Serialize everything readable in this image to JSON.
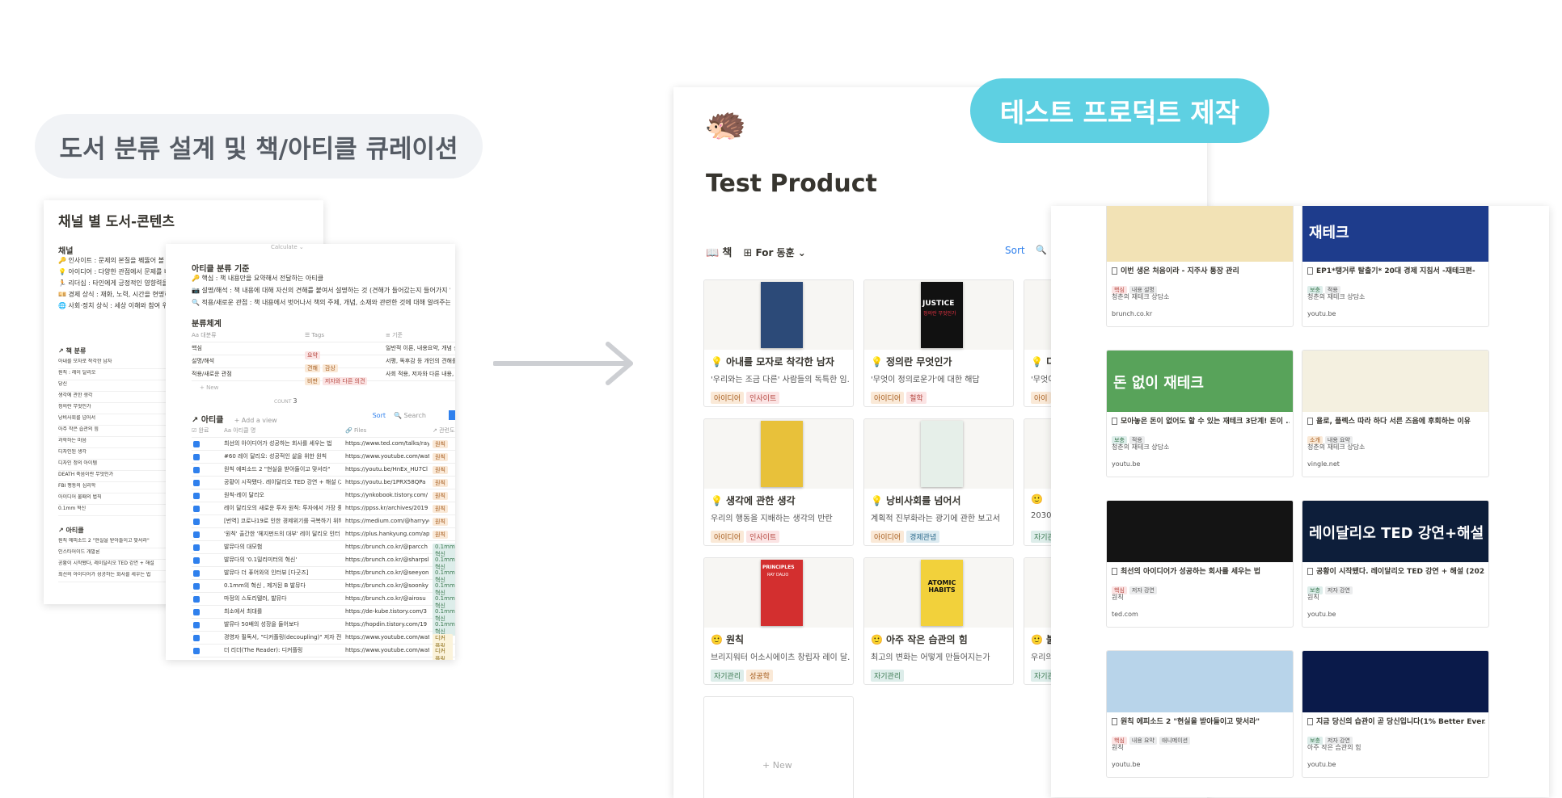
{
  "headings": {
    "left": "도서 분류 설계 및 책/아티클 큐레이션",
    "right": "테스트 프로덕트 제작"
  },
  "doc1": {
    "title": "채널 별 도서-콘텐츠",
    "section": "채널",
    "lines": [
      "🔑 인사이트 : 문제의 본질을 꿰뚫어 볼 수 있는",
      "💡 아이디어 : 다양한 관점에서 문제를 바라볼",
      "🏃 리더십 : 타인에게 긍정적인 영향력을 발휘",
      "💴 경제 상식 : 재화, 노력, 시간을 현명하게 관",
      "🌐 사회·정치 상식 : 세상 이해와 참여 위한 사"
    ],
    "sub1": "↗ 책 분류",
    "rows": [
      "아내를 모자로 착각한 남자",
      "원칙 : 레이 달리오",
      "당신",
      "생각에 관한 생각",
      "정의란 무엇인가",
      "낭비사회를 넘어서",
      "아주 작은 습관의 힘",
      "과학하는 마음",
      "디자인된 생각",
      "디자인 정의 아이템",
      "DEATH 죽음이란 무엇인가",
      "FBI 행동의 심리학",
      "아이디어 불패의 법칙",
      "0.1mm 혁신"
    ],
    "sub2": "↗ 아티클",
    "rows2": [
      "원칙 에피소드 2 \"현실을 받아들이고 맞서라\"",
      "인스타어이드 개발론",
      "공황이 시작됐다, 레이달리오 TED 강연 + 해설",
      "최선의 아이디어가 성공하는 회사를 세우는 법"
    ]
  },
  "doc2": {
    "calc": "Calculate ⌄",
    "title": "아티클 분류 기준",
    "criteria": [
      "🔑 핵심 : 책 내용만을 요약해서 전달하는 아티클",
      "📷 설명/해석 : 책 내용에 대해 자신의 견해를 붙여서 설명하는 것 (견해가 들어갔는지 들어가지 않았는지)",
      "🔍 적용/새로운 관점 : 책 내용에서 벗어나서 책의 주제, 개념, 소재와 관련한 것에 대해 알려주는 아티클"
    ],
    "system_title": "분류체계",
    "cols": [
      "Aa 대분류",
      "☰ Tags",
      "≡ 기준"
    ],
    "cats": [
      {
        "name": "핵심",
        "tags": [
          "요약"
        ],
        "desc": "일반적 이론, 내용요약, 개념 설"
      },
      {
        "name": "설명/해석",
        "tags": [
          "견해",
          "감상"
        ],
        "desc": "서평, 독후감 등 개인의 견해를 ·"
      },
      {
        "name": "적용/새로운 관점",
        "tags": [
          "비판",
          "저자와 다른 의견"
        ],
        "desc": "사회 적용, 저자와 다른 내용, 다"
      }
    ],
    "new": "+ New",
    "count_label": "COUNT",
    "count": "3",
    "articles_title": "↗ 아티클",
    "add_view": "+ Add a view",
    "sort": "Sort",
    "search": "🔍 Search",
    "tcols": [
      "☑ 완료",
      "Aa 아티클 명",
      "🔗 Files",
      "↗ 관련도서"
    ],
    "articles": [
      {
        "t": "최선의 아이디어가 성공하는 회사를 세우는 법",
        "u": "https://www.ted.com/talks/ray",
        "g": "원칙"
      },
      {
        "t": "#60 레이 달리오: 성공적인 삶을 위한 원칙",
        "u": "https://www.youtube.com/wat",
        "g": "원칙"
      },
      {
        "t": "원칙 에피소드 2 \"현실을 받아들이고 맞서라\"",
        "u": "https://youtu.be/HnEx_HU7Cl",
        "g": "원칙"
      },
      {
        "t": "공황이 시작됐다. 레이달리오 TED 강연 + 해설 (2",
        "u": "https://youtu.be/1PRX58QPa",
        "g": "원칙"
      },
      {
        "t": "원칙-레이 달리오",
        "u": "https://ynkobook.tistory.com/",
        "g": "원칙"
      },
      {
        "t": "레이 달리오의 새로운 투자 원칙: 투자에서 가장 중",
        "u": "https://ppss.kr/archives/2019",
        "g": "원칙"
      },
      {
        "t": "[번역] 코로나19로 인한 경제위기를 극복하기 위해",
        "u": "https://medium.com/@harryyc",
        "g": "원칙"
      },
      {
        "t": "'원칙' 출간한 '헤지펀드의 대부' 레이 달리오 인터",
        "u": "https://plus.hankyung.com/ap",
        "g": "원칙"
      },
      {
        "t": "발뮤다의 대모험",
        "u": "https://brunch.co.kr/@parcch",
        "g": "0.1mm혁신"
      },
      {
        "t": "발뮤다의 '0.1밀리미터의 혁신'",
        "u": "https://brunch.co.kr/@sharpsl",
        "g": "0.1mm혁신"
      },
      {
        "t": "발뮤다 더 퓨어와의 인터뷰 [다굿즈]",
        "u": "https://brunch.co.kr/@seeyon",
        "g": "0.1mm혁신"
      },
      {
        "t": "0.1mm의 혁신 , 제거된 B 발뮤다",
        "u": "https://brunch.co.kr/@soonky",
        "g": "0.1mm혁신"
      },
      {
        "t": "마정의 스토리텔러, 발뮤다",
        "u": "https://brunch.co.kr/@airosu",
        "g": "0.1mm혁신"
      },
      {
        "t": "최소에서 최대를",
        "u": "https://de-kube.tistory.com/3",
        "g": "0.1mm혁신"
      },
      {
        "t": "발뮤다 50배의 성장을 들어보다",
        "u": "https://hopdin.tistory.com/19",
        "g": "0.1mm혁신"
      },
      {
        "t": "경영자 필독서, \"디커플링(decoupling)\" 저자 전",
        "u": "https://www.youtube.com/wat",
        "g": "디커플링"
      },
      {
        "t": "더 리더(The Reader): 디커플링",
        "u": "https://www.youtube.com/wat",
        "g": "디커플링"
      }
    ]
  },
  "product": {
    "emoji": "🦔",
    "title": "Test Product",
    "db_icon": "📖",
    "db_name": "책",
    "view_icon": "⊞",
    "view": "For 동훈 ⌄",
    "sort": "Sort",
    "search_icon": "🔍",
    "new_label": "+ New",
    "books": [
      {
        "icon": "💡",
        "title": "아내를 모자로 착각한 남자",
        "desc": "'우리와는 조금 다른' 사람들의 독특한 임...",
        "tags": [
          "아이디어",
          "인사이트"
        ],
        "cover": "#2c4a78"
      },
      {
        "icon": "💡",
        "title": "정의란 무엇인가",
        "desc": "'무엇이 정의로운가'에 대한 해답",
        "tags": [
          "아이디어",
          "철학"
        ],
        "cover": "#111111"
      },
      {
        "icon": "💡",
        "title": "디",
        "desc": "'무엇이",
        "tags": [
          "아이"
        ],
        "cover": "#dddddd"
      },
      {
        "icon": "💡",
        "title": "생각에 관한 생각",
        "desc": "우리의 행동을 지배하는 생각의 반란",
        "tags": [
          "아이디어",
          "인사이트"
        ],
        "cover": "#e8c13a"
      },
      {
        "icon": "💡",
        "title": "낭비사회를 넘어서",
        "desc": "계획적 진부화라는 광기에 관한 보고서",
        "tags": [
          "아이디어",
          "경제관념"
        ],
        "cover": "#e6efe9"
      },
      {
        "icon": "🙂",
        "title": "",
        "desc": "2030",
        "tags": [
          "자기관"
        ],
        "cover": "#dddddd"
      },
      {
        "icon": "🙂",
        "title": "원칙",
        "desc": "브리지워터 어소시에이츠 창립자 레이 달...",
        "tags": [
          "자기관리",
          "성공학"
        ],
        "cover": "#d32f2f"
      },
      {
        "icon": "🙂",
        "title": "아주 작은 습관의 힘",
        "desc": "최고의 변화는 어떻게 만들어지는가",
        "tags": [
          "자기관리"
        ],
        "cover": "#f2d13b"
      },
      {
        "icon": "🙂",
        "title": "불",
        "desc": "우리의",
        "tags": [
          "자기관"
        ],
        "cover": "#dddddd"
      }
    ],
    "cover_texts": {
      "justice": "JUSTICE",
      "justice_sub": "정의란 무엇인가",
      "principles": "PRINCIPLES",
      "principles_sub": "RAY DALIO",
      "atomic": "ATOMIC HABITS"
    }
  },
  "gallery": {
    "cards": [
      {
        "title": "이번 생은 처음이라 - 지주사 통장 관리",
        "tags": [
          "핵심",
          "내용 설명"
        ],
        "sub": "청춘의 재테크 상담소",
        "src": "brunch.co.kr",
        "img": "#f2e2b5",
        "overlay": ""
      },
      {
        "title": "EP1*탱거루 탈출기* 20대 경제 지침서 -재테크편-",
        "tags": [
          "보충",
          "적용"
        ],
        "sub": "청춘의 재테크 상담소",
        "src": "youtu.be",
        "img": "#1e3c8c",
        "overlay": "재테크"
      },
      {
        "title": "모아놓은 돈이 없어도 할 수 있는 재테크 3단계! 돈이 ...",
        "tags": [
          "보충",
          "적용"
        ],
        "sub": "청춘의 재테크 상담소",
        "src": "youtu.be",
        "img": "#58a35a",
        "overlay": "돈 없이 재테크"
      },
      {
        "title": "욜로, 플렉스 따라 하다 서른 즈음에 후회하는 이유",
        "tags": [
          "소개",
          "내용 요약"
        ],
        "sub": "청춘의 재테크 상담소",
        "src": "vingle.net",
        "img": "#f4f0e0",
        "overlay": ""
      },
      {
        "title": "최선의 아이디어가 성공하는 회사를 세우는 법",
        "tags": [
          "핵심",
          "저자 강연"
        ],
        "sub": "원칙",
        "src": "ted.com",
        "img": "#141414",
        "overlay": ""
      },
      {
        "title": "공황이 시작됐다. 레이달리오 TED 강연 + 해설 (202...",
        "tags": [
          "보충",
          "저자 강연"
        ],
        "sub": "원칙",
        "src": "youtu.be",
        "img": "#0d1e3a",
        "overlay": "레이달리오 TED 강연+해설"
      },
      {
        "title": "원칙 에피소드 2 \"현실을 받아들이고 맞서라\"",
        "tags": [
          "핵심",
          "내용 요약",
          "애니메이션"
        ],
        "sub": "원칙",
        "src": "youtu.be",
        "img": "#b8d4ea",
        "overlay": ""
      },
      {
        "title": "지금 당신의 습관이 곧 당신입니다(1% Better Ever...",
        "tags": [
          "보충",
          "저자 강연"
        ],
        "sub": "아주 작은 습관의 힘",
        "src": "youtu.be",
        "img": "#0a1a4a",
        "overlay": ""
      }
    ]
  },
  "colors": {
    "pill_right": "#5ed0e2",
    "pill_left": "#f1f3f6",
    "arrow": "#cdcfd3",
    "accent": "#2f80ed"
  }
}
